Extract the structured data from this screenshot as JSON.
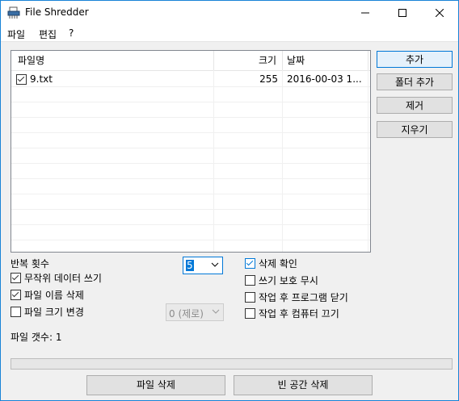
{
  "window": {
    "title": "File Shredder"
  },
  "menu": [
    "파일",
    "편집",
    "?"
  ],
  "file_list": {
    "columns": [
      "파일명",
      "크기",
      "날짜"
    ],
    "rows": [
      {
        "checked": true,
        "name": "9.txt",
        "size": "255",
        "date": "2016-00-03 1..."
      }
    ]
  },
  "buttons": {
    "add": "추가",
    "add_folder": "폴더 추가",
    "remove": "제거",
    "clear": "지우기",
    "delete_files": "파일 삭제",
    "wipe_free_space": "빈 공간 삭제"
  },
  "options": {
    "repeat_label": "반복 횟수",
    "repeat_value": "5",
    "random_data": {
      "label": "무작위 데이터 쓰기",
      "checked": true
    },
    "delete_filename": {
      "label": "파일 이름 삭제",
      "checked": true
    },
    "change_size": {
      "label": "파일 크기 변경",
      "checked": false
    },
    "size_value": "0 (제로)",
    "confirm_delete": {
      "label": "삭제 확인",
      "checked": true
    },
    "ignore_write_protect": {
      "label": "쓰기 보호 무시",
      "checked": false
    },
    "close_after": {
      "label": "작업 후 프로그램 닫기",
      "checked": false
    },
    "shutdown_after": {
      "label": "작업 후 컴퓨터 끄기",
      "checked": false
    }
  },
  "status": {
    "file_count": "파일 갯수: 1"
  },
  "progress": {
    "value": 0
  }
}
